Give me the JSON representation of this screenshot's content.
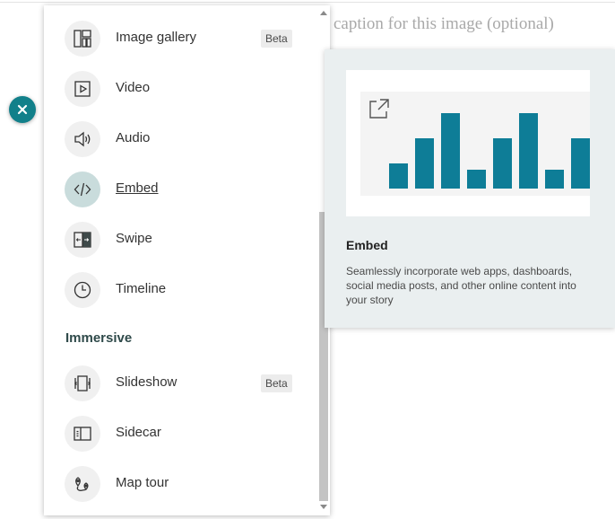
{
  "caption": {
    "placeholder": "caption for this image (optional)"
  },
  "close_button": {
    "icon": "close-icon",
    "color": "#12808a"
  },
  "menu": {
    "items_top": [
      {
        "label": "Image gallery",
        "icon": "image-gallery-icon",
        "badge": "Beta",
        "active": false
      },
      {
        "label": "Video",
        "icon": "video-icon",
        "active": false
      },
      {
        "label": "Audio",
        "icon": "audio-icon",
        "active": false
      },
      {
        "label": "Embed",
        "icon": "embed-icon",
        "active": true
      },
      {
        "label": "Swipe",
        "icon": "swipe-icon",
        "active": false
      },
      {
        "label": "Timeline",
        "icon": "timeline-icon",
        "active": false
      }
    ],
    "section_label": "Immersive",
    "items_immersive": [
      {
        "label": "Slideshow",
        "icon": "slideshow-icon",
        "badge": "Beta"
      },
      {
        "label": "Sidecar",
        "icon": "sidecar-icon"
      },
      {
        "label": "Map tour",
        "icon": "map-tour-icon"
      }
    ]
  },
  "preview": {
    "title": "Embed",
    "description": "Seamlessly incorporate web apps, dashboards, social media posts, and other online content into your story",
    "chart_data": {
      "type": "bar",
      "values": [
        2,
        4,
        6,
        1.5,
        4,
        6,
        1.5,
        4
      ],
      "color": "#0e7d97",
      "background": "#f4f4f4"
    }
  }
}
